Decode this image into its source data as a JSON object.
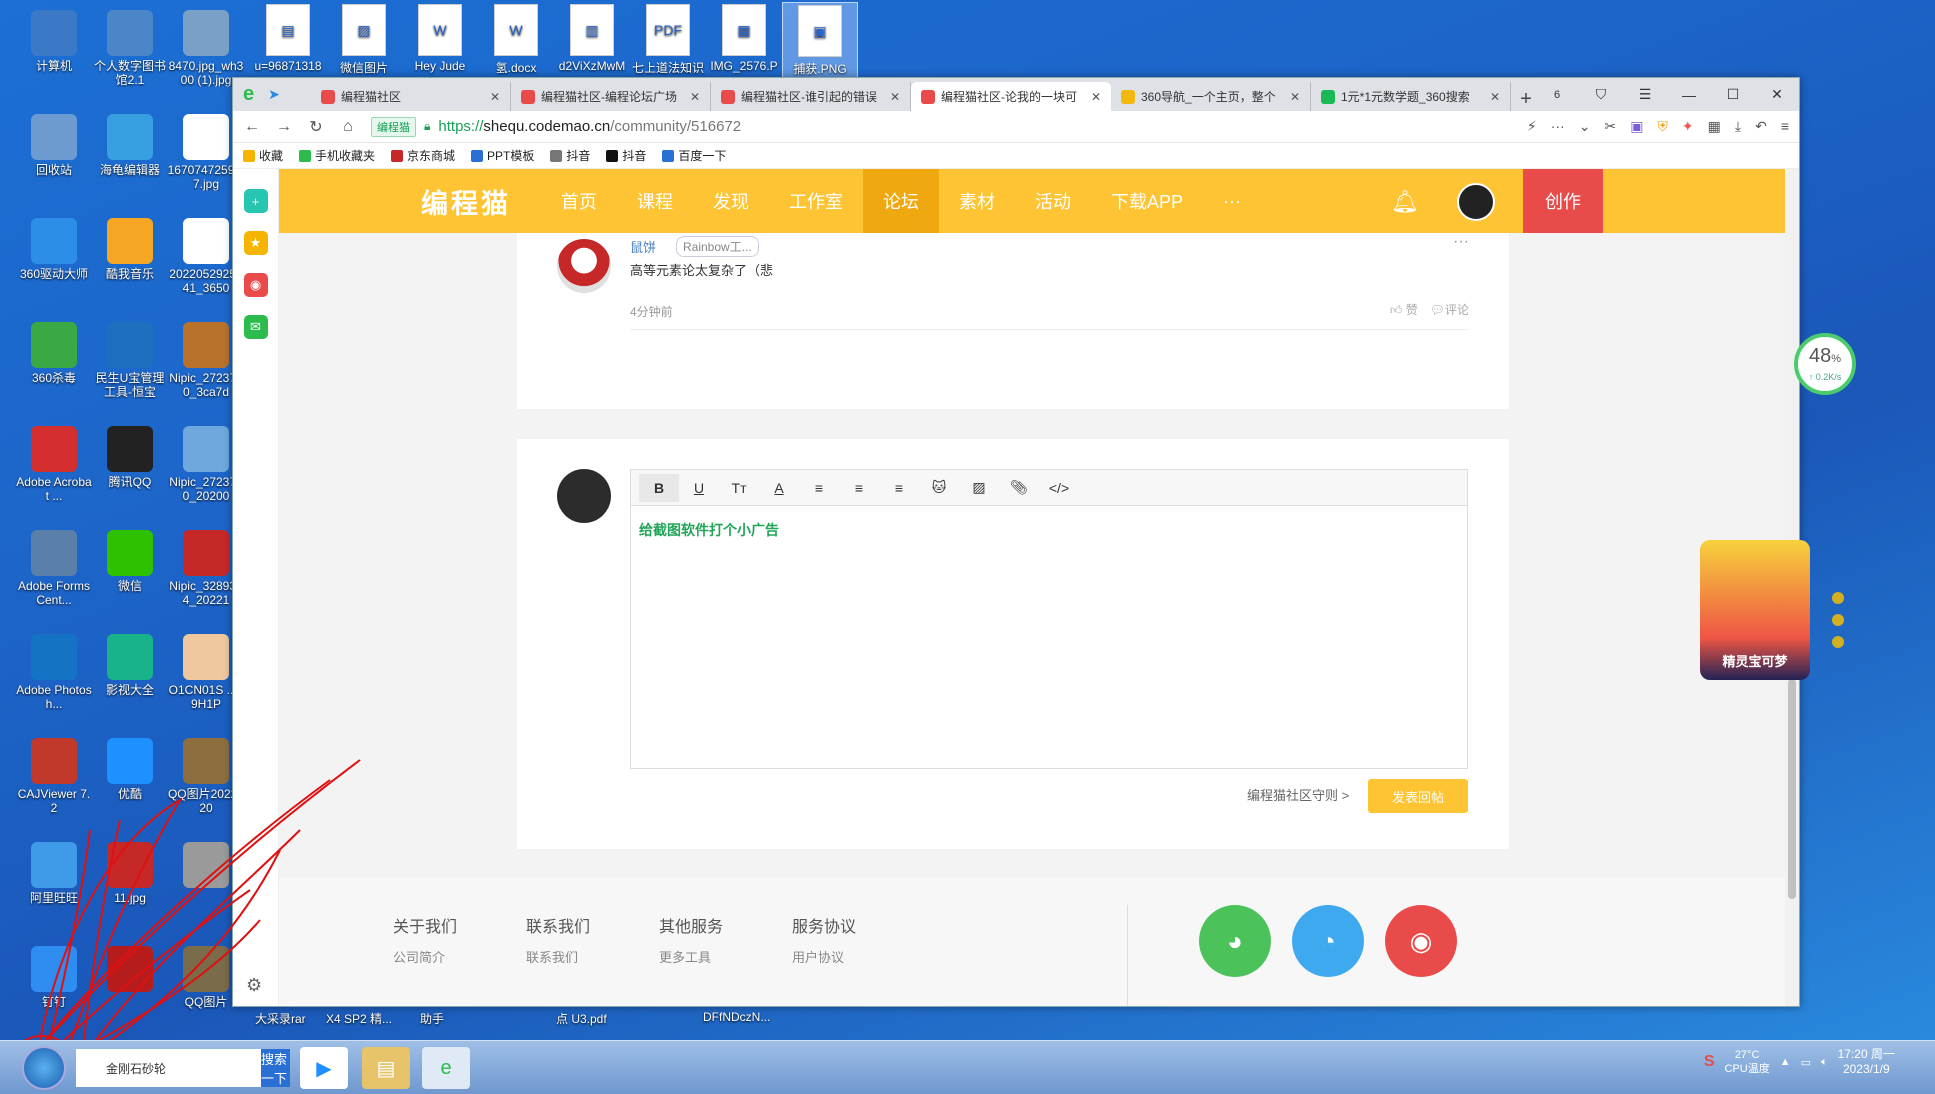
{
  "desktop_left": [
    {
      "label": "计算机",
      "color": "#3b78c6"
    },
    {
      "label": "个人数字图书馆2.1",
      "color": "#4a86c8"
    },
    {
      "label": "8470.jpg_wh300 (1).jpg",
      "color": "#7aa0c8"
    },
    {
      "label": "回收站",
      "color": "#6b9bd0"
    },
    {
      "label": "海龟编辑器",
      "color": "#36a0e0"
    },
    {
      "label": "1670747259 77.jpg",
      "color": "#ffffff"
    },
    {
      "label": "360驱动大师",
      "color": "#2d8ee8"
    },
    {
      "label": "酷我音乐",
      "color": "#f5a623"
    },
    {
      "label": "2022052925441_3650",
      "color": "#ffffff"
    },
    {
      "label": "360杀毒",
      "color": "#3aa845"
    },
    {
      "label": "民生U宝管理工具-恒宝",
      "color": "#1f6fbf"
    },
    {
      "label": "Nipic_2723770_3ca7d",
      "color": "#b8722c"
    },
    {
      "label": "Adobe Acrobat ...",
      "color": "#d32f2f"
    },
    {
      "label": "腾讯QQ",
      "color": "#222222"
    },
    {
      "label": "Nipic_2723770_20200",
      "color": "#6fa8dc"
    },
    {
      "label": "Adobe FormsCent...",
      "color": "#5a7fa8"
    },
    {
      "label": "微信",
      "color": "#2dc100"
    },
    {
      "label": "Nipic_3289324_20221",
      "color": "#c62828"
    },
    {
      "label": "Adobe Photosh...",
      "color": "#1473c4"
    },
    {
      "label": "影视大全",
      "color": "#19b38a"
    },
    {
      "label": "O1CN01S ...59H1P",
      "color": "#f0c8a0"
    },
    {
      "label": "CAJViewer 7.2",
      "color": "#c0392b"
    },
    {
      "label": "优酷",
      "color": "#1e90ff"
    },
    {
      "label": "QQ图片2022120",
      "color": "#8d6e3f"
    },
    {
      "label": "阿里旺旺",
      "color": "#3f9ae8"
    },
    {
      "label": "11.jpg",
      "color": "#c62828"
    },
    {
      "label": "",
      "color": "#9a9a9a"
    },
    {
      "label": "钉钉",
      "color": "#2f8cf0"
    },
    {
      "label": "",
      "color": "#b71c1c"
    },
    {
      "label": "QQ图片",
      "color": "#7a6b4a"
    }
  ],
  "desktop_top": [
    {
      "label": "u=96871318",
      "glyph": "▤"
    },
    {
      "label": "微信图片",
      "glyph": "▨"
    },
    {
      "label": "Hey Jude",
      "glyph": "W"
    },
    {
      "label": "氢.docx",
      "glyph": "W"
    },
    {
      "label": "d2ViXzMwM",
      "glyph": "▥"
    },
    {
      "label": "七上道法知识",
      "glyph": "PDF"
    },
    {
      "label": "IMG_2576.P",
      "glyph": "▦"
    },
    {
      "label": "捕获.PNG",
      "glyph": "▣"
    }
  ],
  "bottom_labels": [
    "大采录rar",
    "X4 SP2 精...",
    "助手",
    "点 U3.pdf",
    "DFfNDczN..."
  ],
  "browser": {
    "tabs": [
      {
        "title": "编程猫社区",
        "color": "#e94b4b"
      },
      {
        "title": "编程猫社区-编程论坛广场",
        "color": "#e94b4b"
      },
      {
        "title": "编程猫社区-谁引起的错误",
        "color": "#e94b4b"
      },
      {
        "title": "编程猫社区-论我的一块可",
        "color": "#e94b4b"
      },
      {
        "title": "360导航_一个主页，整个",
        "color": "#f2b90c"
      },
      {
        "title": "1元*1元数学题_360搜索",
        "color": "#19b955"
      }
    ],
    "tab_count": "6",
    "site_badge": "编程猫",
    "url_https": "https://",
    "url_host": "shequ.codemao.cn",
    "url_path": "/community/516672",
    "bookmarks": [
      "收藏",
      "手机收藏夹",
      "京东商城",
      "PPT模板",
      "抖音",
      "抖音",
      "百度一下"
    ]
  },
  "site": {
    "logo": "编程猫",
    "menu": [
      "首页",
      "课程",
      "发现",
      "工作室",
      "论坛",
      "素材",
      "活动",
      "下载APP",
      "···"
    ],
    "active_menu": "论坛",
    "create": "创作"
  },
  "comment": {
    "user": "鼠饼",
    "badge": "Rainbow工...",
    "text": "高等元素论太复杂了（悲",
    "time": "4分钟前",
    "like": "赞",
    "reply": "评论"
  },
  "editor": {
    "content": "给截图软件打个小广告",
    "rules": "编程猫社区守则 >",
    "post": "发表回帖"
  },
  "footer": {
    "cols": [
      {
        "title": "关于我们",
        "sub": "公司简介"
      },
      {
        "title": "联系我们",
        "sub": "联系我们"
      },
      {
        "title": "其他服务",
        "sub": "更多工具"
      },
      {
        "title": "服务协议",
        "sub": "用户协议"
      }
    ]
  },
  "speed": {
    "pct": "48",
    "unit": "%",
    "rate": "↑ 0.2K/s"
  },
  "pika_label": "精灵宝可梦",
  "taskbar": {
    "search_placeholder": "金刚石砂轮",
    "search_btn": "搜索一下",
    "temp": "27°C",
    "temp_label": "CPU温度",
    "time": "17:20 周一",
    "date": "2023/1/9"
  }
}
